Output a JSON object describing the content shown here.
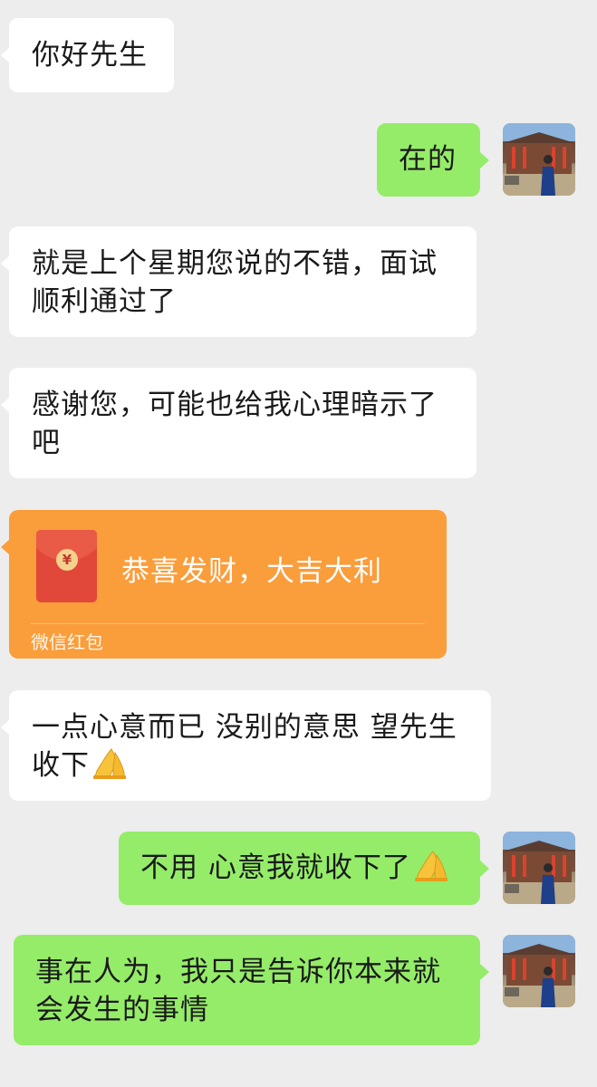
{
  "messages": [
    {
      "side": "left",
      "text": "你好先生"
    },
    {
      "side": "right",
      "text": "在的"
    },
    {
      "side": "left",
      "line1": "就是上个星期您说的不错，面试",
      "line2": "顺利通过了"
    },
    {
      "side": "left",
      "line1": "感谢您，可能也给我心理暗示了",
      "line2": "吧"
    },
    {
      "side": "left",
      "type": "red-packet",
      "title": "恭喜发财，大吉大利",
      "label": "微信红包",
      "coin": "¥"
    },
    {
      "side": "left",
      "line1": "一点心意而已 没别的意思 望先生",
      "line2": "收下",
      "emoji": "folded-hands-icon"
    },
    {
      "side": "right",
      "text": "不用 心意我就收下了",
      "emoji": "folded-hands-icon"
    },
    {
      "side": "right",
      "line1": "事在人为，我只是告诉你本来就",
      "line2": "会发生的事情"
    }
  ],
  "colors": {
    "background": "#ededed",
    "incoming_bubble": "#ffffff",
    "outgoing_bubble": "#95ec69",
    "red_packet": "#fa9d3b",
    "envelope": "#e2483a"
  }
}
